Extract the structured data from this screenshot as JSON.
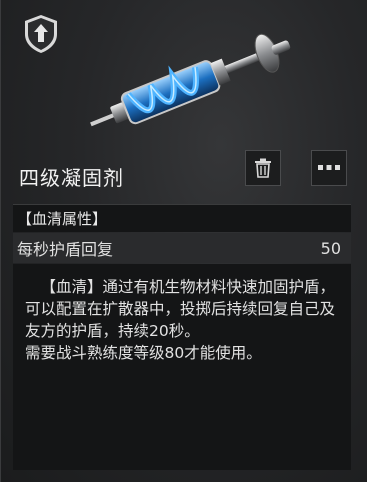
{
  "item": {
    "name": "四级凝固剂",
    "section_label": "【血清属性】",
    "stats": [
      {
        "label": "每秒护盾回复",
        "value": "50"
      }
    ],
    "description": "【血清】通过有机生物材料快速加固护盾，可以配置在扩散器中，投掷后持续回复自己及友方的护盾，持续20秒。",
    "requirement": "需要战斗熟练度等级80才能使用。"
  },
  "icons": {
    "badge": "rank-shield-arrow-icon",
    "hero": "syringe-item-image",
    "trash": "trash-icon",
    "more": "more-dots-icon"
  },
  "colors": {
    "accent_blue": "#2a8fe0",
    "panel_dark": "#141516",
    "row_gray": "#2a2b2d"
  }
}
